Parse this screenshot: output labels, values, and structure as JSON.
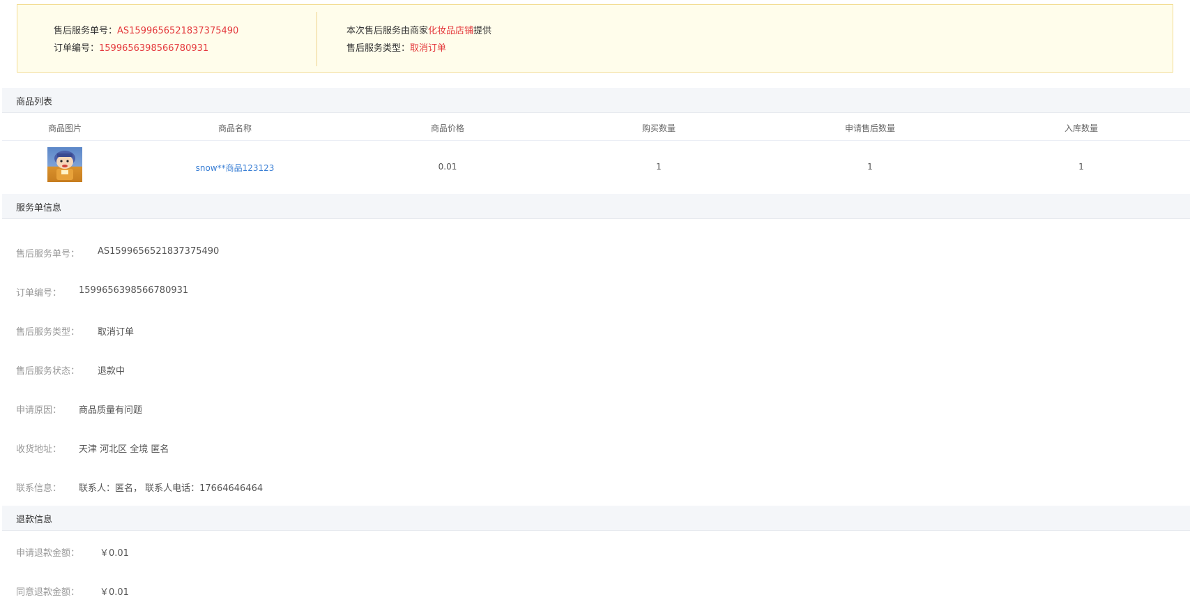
{
  "notice": {
    "service_no_label": "售后服务单号：",
    "service_no": "AS1599656521837375490",
    "order_no_label": "订单编号：",
    "order_no": "1599656398566780931",
    "provider_prefix": "本次售后服务由商家",
    "provider_name": "化妆品店铺",
    "provider_suffix": "提供",
    "type_label": "售后服务类型：",
    "type_value": "取消订单"
  },
  "product_section": {
    "title": "商品列表",
    "columns": [
      "商品图片",
      "商品名称",
      "商品价格",
      "购买数量",
      "申请售后数量",
      "入库数量"
    ],
    "rows": [
      {
        "name": "snow**商品123123",
        "price": "0.01",
        "qty": "1",
        "apply_qty": "1",
        "stock_qty": "1"
      }
    ]
  },
  "service_section": {
    "title": "服务单信息",
    "items": [
      {
        "label": "售后服务单号：",
        "value": "AS1599656521837375490"
      },
      {
        "label": "订单编号：",
        "value": "1599656398566780931"
      },
      {
        "label": "售后服务类型：",
        "value": "取消订单"
      },
      {
        "label": "售后服务状态：",
        "value": "退款中"
      },
      {
        "label": "申请原因：",
        "value": "商品质量有问题"
      },
      {
        "label": "收货地址：",
        "value": "天津 河北区 全境 匿名"
      },
      {
        "label": "联系信息：",
        "value": "联系人：匿名， 联系人电话：17664646464"
      }
    ]
  },
  "refund_section": {
    "title": "退款信息",
    "items": [
      {
        "label": "申请退款金额：",
        "value": "￥0.01"
      },
      {
        "label": "同意退款金额：",
        "value": "￥0.01"
      }
    ]
  }
}
